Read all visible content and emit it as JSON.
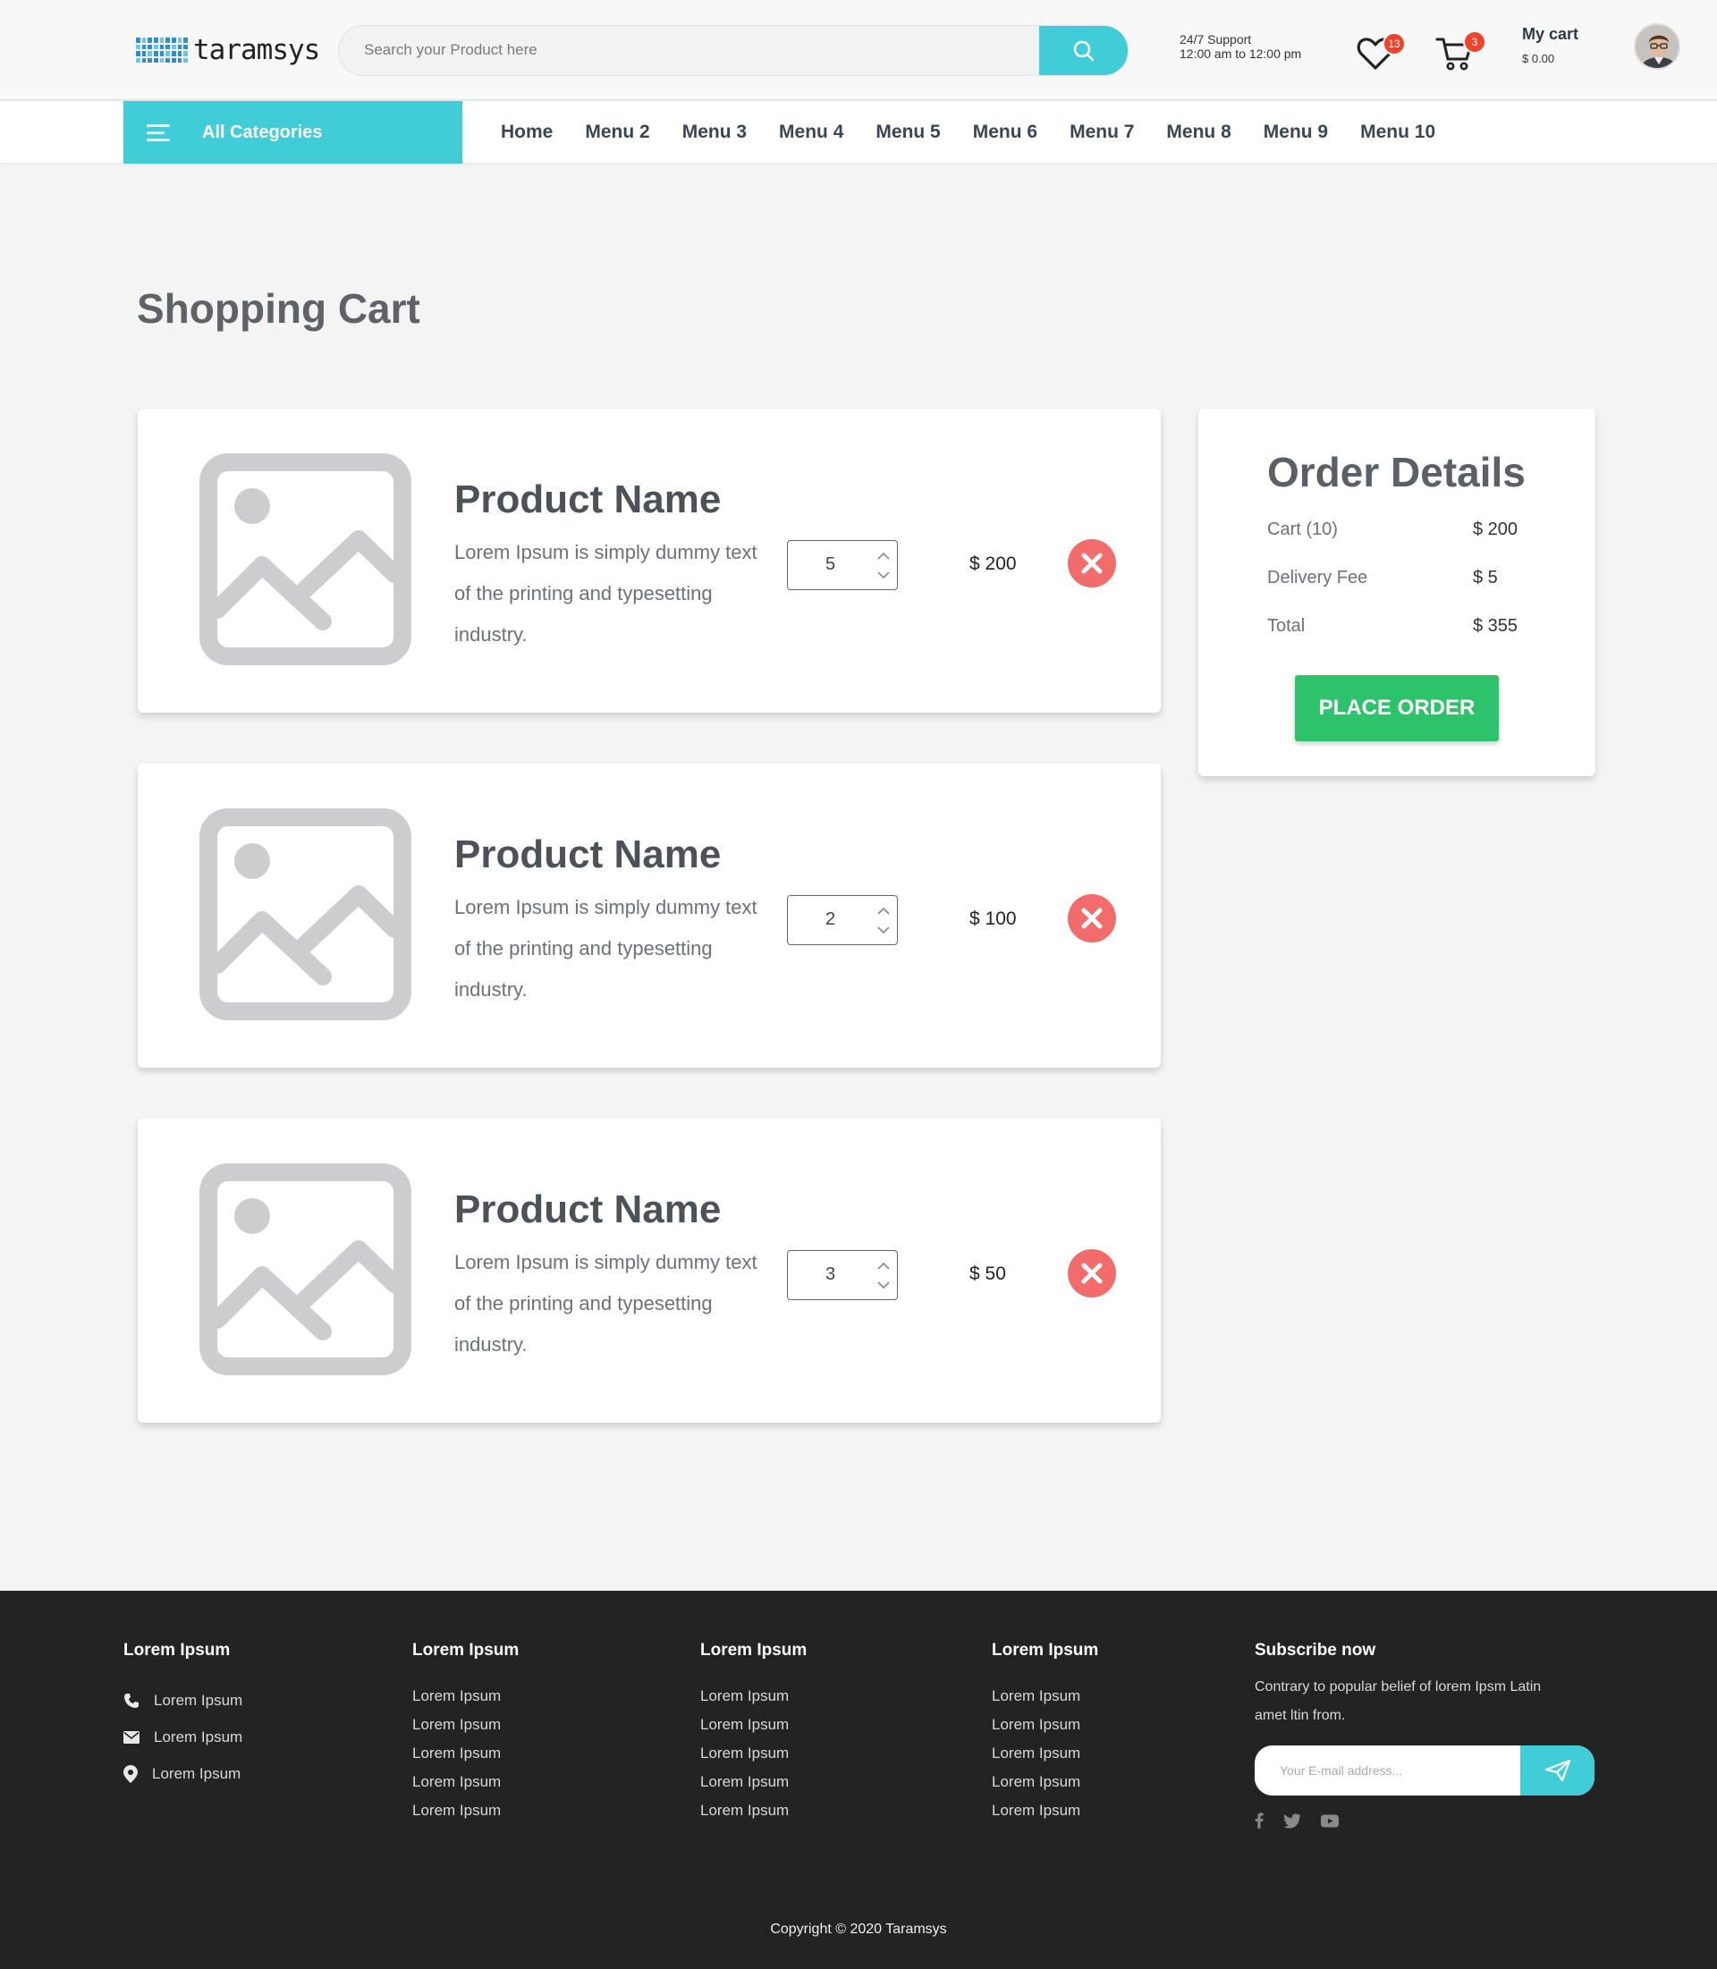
{
  "header": {
    "logo_text": "taramsys",
    "search_placeholder": "Search your Product here",
    "support_line1": "24/7 Support",
    "support_line2": "12:00 am to 12:00 pm",
    "wishlist_count": "13",
    "cart_count": "3",
    "mycart_label": "My cart",
    "mycart_value": "$ 0.00",
    "accent_color": "#40cdd7"
  },
  "nav": {
    "all_categories": "All Categories",
    "items": [
      "Home",
      "Menu 2",
      "Menu 3",
      "Menu 4",
      "Menu 5",
      "Menu 6",
      "Menu 7",
      "Menu 8",
      "Menu 9",
      "Menu 10"
    ]
  },
  "page": {
    "title": "Shopping Cart"
  },
  "cart_items": [
    {
      "name": "Product Name",
      "desc": "Lorem Ipsum is simply dummy text of the printing and typesetting industry.",
      "qty": "5",
      "price": "$ 200"
    },
    {
      "name": "Product Name",
      "desc": "Lorem Ipsum is simply dummy text of the printing and typesetting industry.",
      "qty": "2",
      "price": "$ 100"
    },
    {
      "name": "Product Name",
      "desc": "Lorem Ipsum is simply dummy text of the printing and typesetting industry.",
      "qty": "3",
      "price": "$ 50"
    }
  ],
  "order": {
    "title": "Order Details",
    "rows": [
      {
        "label": "Cart (10)",
        "value": "$ 200"
      },
      {
        "label": "Delivery Fee",
        "value": "$ 5"
      },
      {
        "label": "Total",
        "value": "$ 355"
      }
    ],
    "button": "PLACE ORDER",
    "button_color": "#2cc36b"
  },
  "footer": {
    "col1": {
      "title": "Lorem Ipsum",
      "items": [
        "Lorem Ipsum",
        "Lorem Ipsum",
        "Lorem Ipsum"
      ]
    },
    "col2": {
      "title": "Lorem Ipsum",
      "items": [
        "Lorem Ipsum",
        "Lorem Ipsum",
        "Lorem Ipsum",
        "Lorem Ipsum",
        "Lorem Ipsum"
      ]
    },
    "col3": {
      "title": "Lorem Ipsum",
      "items": [
        "Lorem Ipsum",
        "Lorem Ipsum",
        "Lorem Ipsum",
        "Lorem Ipsum",
        "Lorem Ipsum"
      ]
    },
    "col4": {
      "title": "Lorem Ipsum",
      "items": [
        "Lorem Ipsum",
        "Lorem Ipsum",
        "Lorem Ipsum",
        "Lorem Ipsum",
        "Lorem Ipsum"
      ]
    },
    "subscribe": {
      "title": "Subscribe now",
      "text": "Contrary to popular belief of lorem Ipsm Latin amet ltin from.",
      "placeholder": "Your E-mail address..."
    },
    "social_icons": [
      "facebook-icon",
      "twitter-icon",
      "youtube-icon"
    ],
    "copyright": "Copyright © 2020 Taramsys"
  }
}
